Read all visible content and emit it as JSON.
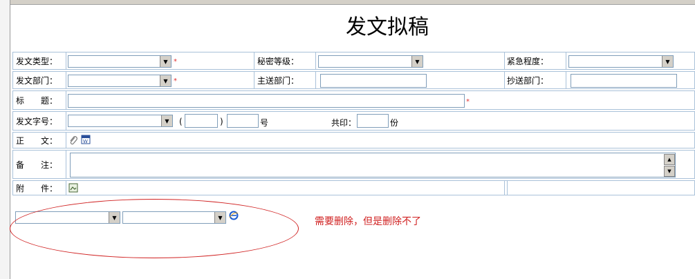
{
  "page": {
    "title": "发文拟稿"
  },
  "form": {
    "doc_type": {
      "label": "发文类型："
    },
    "secret_level": {
      "label": "秘密等级："
    },
    "urgency": {
      "label": "紧急程度："
    },
    "issuing_dept": {
      "label": "发文部门："
    },
    "main_recipient": {
      "label": "主送部门："
    },
    "cc_dept": {
      "label": "抄送部门："
    },
    "subject": {
      "label": "标　　题："
    },
    "doc_number": {
      "label": "发文字号：",
      "open_paren": "(",
      "close_paren": ")",
      "unit": "号",
      "copies_label": "共印：",
      "copies_unit": "份"
    },
    "body_text": {
      "label": "正　　文："
    },
    "remarks": {
      "label": "备　　注："
    },
    "attachments": {
      "label": "附　　件："
    },
    "required_mark": "*"
  },
  "annotation": {
    "note": "需要删除，但是删除不了",
    "color": "#d02020"
  },
  "colors": {
    "border": "#a9c1d9",
    "required": "#e03030"
  }
}
